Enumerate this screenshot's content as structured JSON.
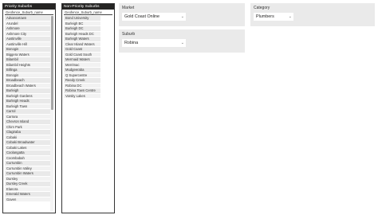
{
  "priority": {
    "title": "Priority Suburbs",
    "column_header": "Geofence_Suburb_name",
    "rows": [
      "Advancetown",
      "Arundel",
      "Ashmore",
      "Ashmore City",
      "Austinville",
      "Austinville Hill",
      "Bonogin",
      "Biggera Waters",
      "Bilambil",
      "Bilambil Heights",
      "Billinga",
      "Bonogin",
      "Broadbeach",
      "Broadbeach Waters",
      "Burleigh",
      "Burleigh Gardens",
      "Burleigh Heads",
      "Burleigh Town",
      "Carrol",
      "Carrara",
      "Chevron Island",
      "Chirn Park",
      "Clagiraba",
      "Cobaki",
      "Cobaki Broadwater",
      "Cobaki Lakes",
      "Coolangatta",
      "Coombabah",
      "Currumbin",
      "Currumbin Valley",
      "Currumbin Waters",
      "Dursley",
      "Dursley Creek",
      "Elanora",
      "Emerald Waters",
      "Gaven"
    ]
  },
  "nonpriority": {
    "title": "Non-Priority Suburbs",
    "column_header": "Geofence_Suburb_name",
    "rows": [
      "Bond University",
      "Burleigh BC",
      "Burleigh DC",
      "Burleigh Heads DC",
      "Burleigh Waters",
      "Clear Island Waters",
      "Gold Coast",
      "Gold Coast South",
      "Mermaid Waters",
      "Merrimac",
      "Mudgeeraba",
      "Q Supercentre",
      "Reedy Creek",
      "Robina DC",
      "Robina Town Centre",
      "Varsity Lakes"
    ]
  },
  "market": {
    "label": "Market",
    "value": "Gold Coast Online"
  },
  "suburb": {
    "label": "Suburb",
    "value": "Robina"
  },
  "category": {
    "label": "Category",
    "value": "Plumbers"
  },
  "icons": {
    "dropdown": "chevron-down-icon"
  }
}
